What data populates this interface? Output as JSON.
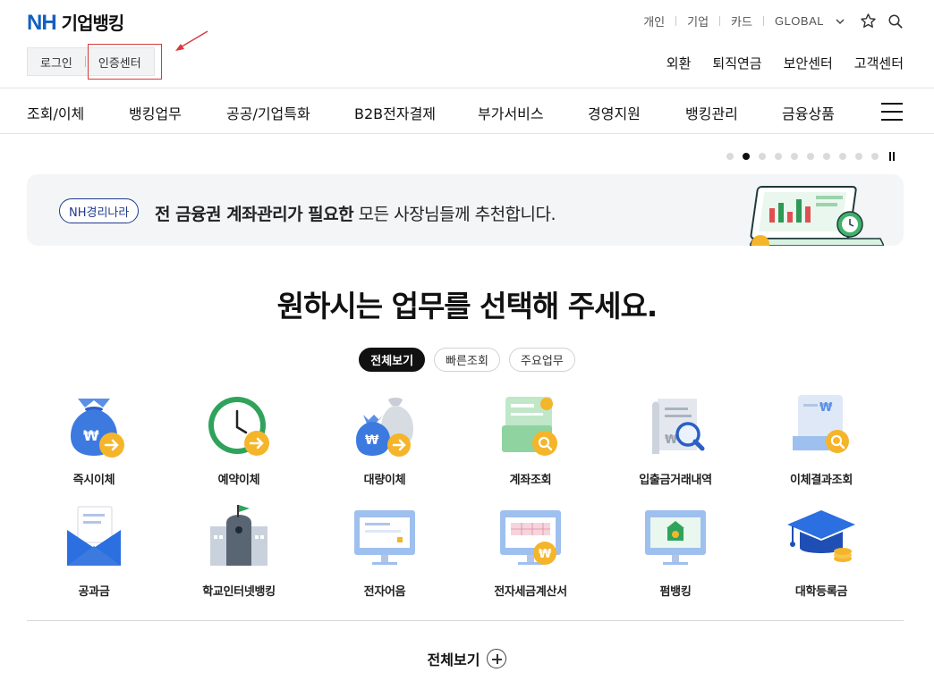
{
  "header": {
    "logo_nh": "NH",
    "logo_title": "기업뱅킹",
    "util_links": [
      "개인",
      "기업",
      "카드"
    ],
    "global_label": "GLOBAL",
    "login_label": "로그인",
    "cert_label": "인증센터",
    "quick_links": [
      "외환",
      "퇴직연금",
      "보안센터",
      "고객센터"
    ]
  },
  "gnb": {
    "items": [
      "조회/이체",
      "뱅킹업무",
      "공공/기업특화",
      "B2B전자결제",
      "부가서비스",
      "경영지원",
      "뱅킹관리",
      "금융상품"
    ]
  },
  "slider": {
    "total": 10,
    "active_index": 1
  },
  "banner": {
    "tag": "NH경리나라",
    "text_bold": "전 금융권 계좌관리가 필요한",
    "text_rest": " 모든 사장님들께 추천합니다."
  },
  "main": {
    "heading": "원하시는 업무를 선택해 주세요.",
    "tabs": [
      "전체보기",
      "빠른조회",
      "주요업무"
    ],
    "services_row1": [
      "즉시이체",
      "예약이체",
      "대량이체",
      "계좌조회",
      "입출금거래내역",
      "이체결과조회"
    ],
    "services_row2": [
      "공과금",
      "학교인터넷뱅킹",
      "전자어음",
      "전자세금계산서",
      "펌뱅킹",
      "대학등록금"
    ],
    "more_label": "전체보기"
  },
  "colors": {
    "brand": "#1460c0",
    "highlight": "#d63b3b",
    "accent_orange": "#f5a623"
  }
}
